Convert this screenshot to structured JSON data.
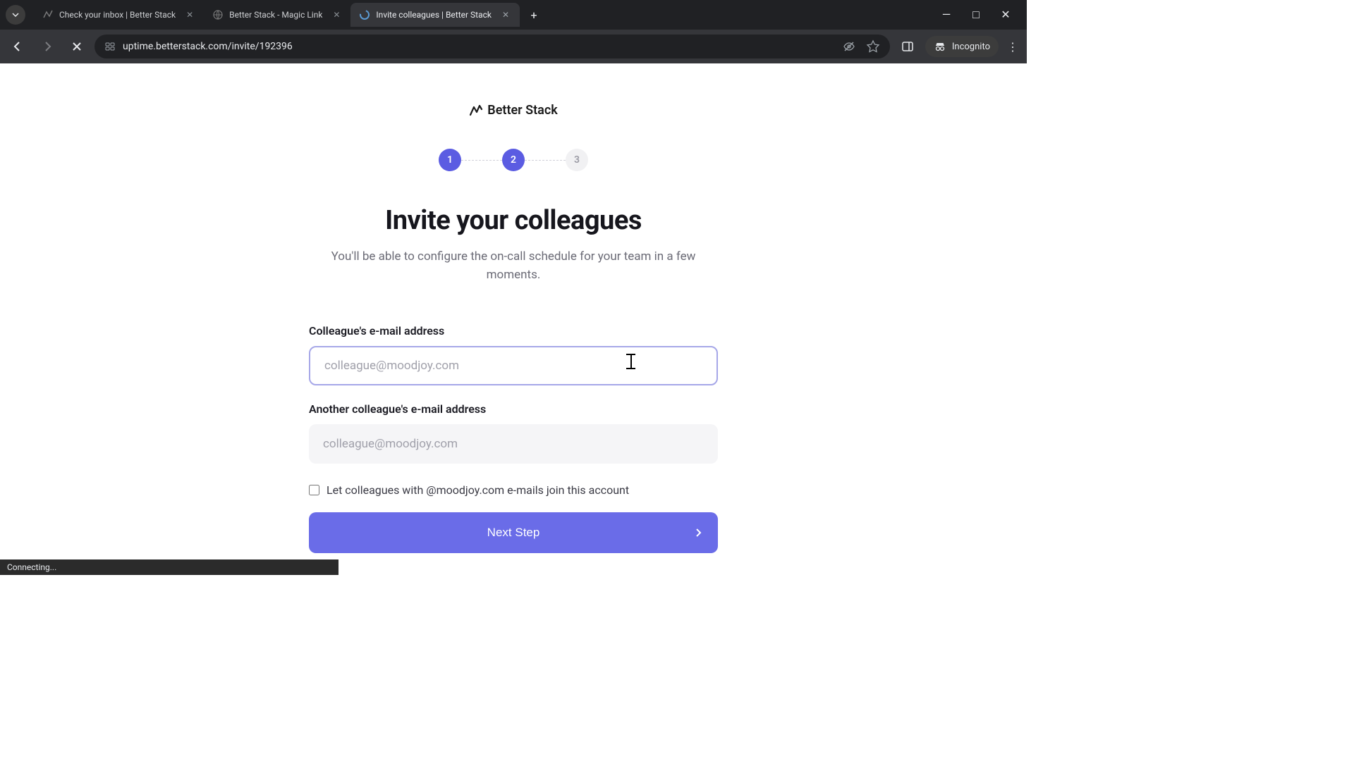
{
  "browser": {
    "tabs": [
      {
        "title": "Check your inbox | Better Stack",
        "active": false
      },
      {
        "title": "Better Stack - Magic Link",
        "active": false
      },
      {
        "title": "Invite colleagues | Better Stack",
        "active": true
      }
    ],
    "url": "uptime.betterstack.com/invite/192396",
    "incognito_label": "Incognito",
    "status_text": "Connecting..."
  },
  "page": {
    "logo_text": "Better Stack",
    "steps": [
      "1",
      "2",
      "3"
    ],
    "heading": "Invite your colleagues",
    "subheading": "You'll be able to configure the on-call schedule for your team in a few moments.",
    "field1_label": "Colleague's e-mail address",
    "field1_placeholder": "colleague@moodjoy.com",
    "field2_label": "Another colleague's e-mail address",
    "field2_placeholder": "colleague@moodjoy.com",
    "checkbox_label": "Let colleagues with @moodjoy.com e-mails join this account",
    "next_button": "Next Step"
  }
}
